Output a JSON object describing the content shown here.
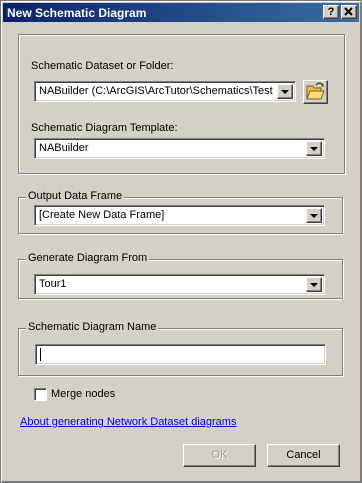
{
  "window": {
    "title": "New Schematic Diagram",
    "help_button": "?",
    "close_button": "X"
  },
  "dataset": {
    "label": "Schematic Dataset or Folder:",
    "value": "NABuilder (C:\\ArcGIS\\ArcTutor\\Schematics\\Tests\\N"
  },
  "template": {
    "label": "Schematic Diagram Template:",
    "value": "NABuilder"
  },
  "output_frame": {
    "legend": "Output Data Frame",
    "value": "[Create New Data Frame]"
  },
  "generate_from": {
    "legend": "Generate Diagram From",
    "value": "Tour1"
  },
  "diagram_name": {
    "legend": "Schematic Diagram Name",
    "value": ""
  },
  "merge_nodes": {
    "label": "Merge nodes",
    "checked": false
  },
  "help_link": "About generating Network Dataset diagrams",
  "buttons": {
    "ok": "OK",
    "cancel": "Cancel"
  },
  "colors": {
    "titlebar_start": "#0a246a",
    "titlebar_end": "#3a6ea5",
    "link": "#0000ee",
    "dialog_bg": "#d4d0c8"
  }
}
